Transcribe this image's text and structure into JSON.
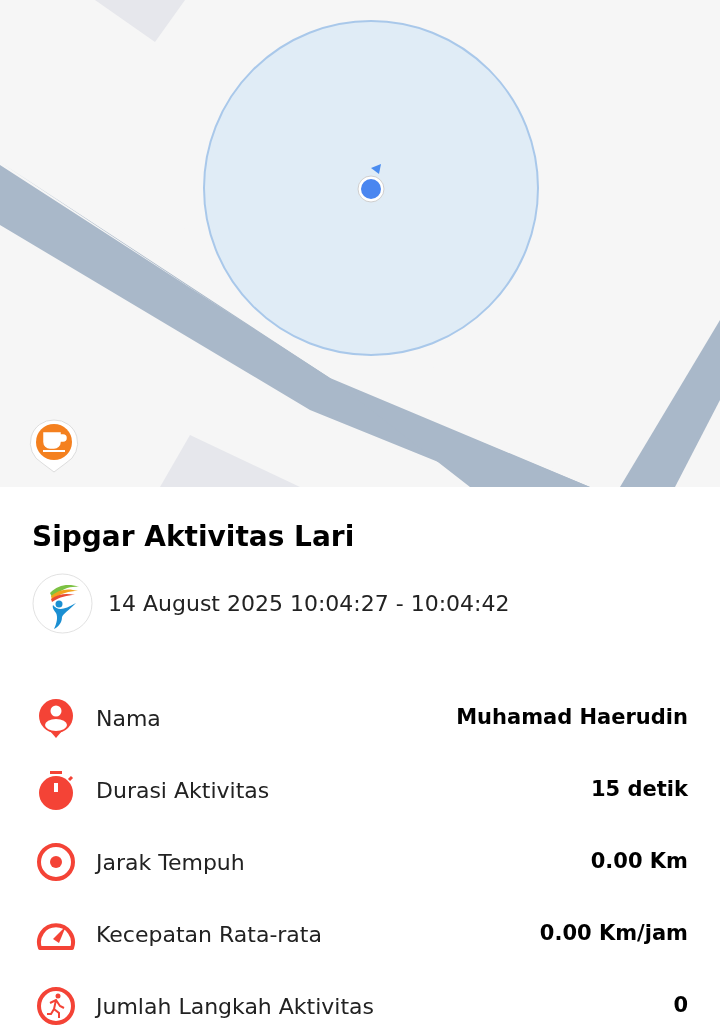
{
  "title": "Sipgar Aktivitas Lari",
  "date_range": "14 August 2025 10:04:27 - 10:04:42",
  "details": [
    {
      "kind": "person",
      "label": "Nama",
      "value": "Muhamad Haerudin"
    },
    {
      "kind": "timer",
      "label": "Durasi Aktivitas",
      "value": "15 detik"
    },
    {
      "kind": "target",
      "label": "Jarak Tempuh",
      "value": "0.00 Km"
    },
    {
      "kind": "speed",
      "label": "Kecepatan Rata-rata",
      "value": "0.00 Km/jam"
    },
    {
      "kind": "steps",
      "label": "Jumlah Langkah Aktivitas",
      "value": "0"
    }
  ]
}
